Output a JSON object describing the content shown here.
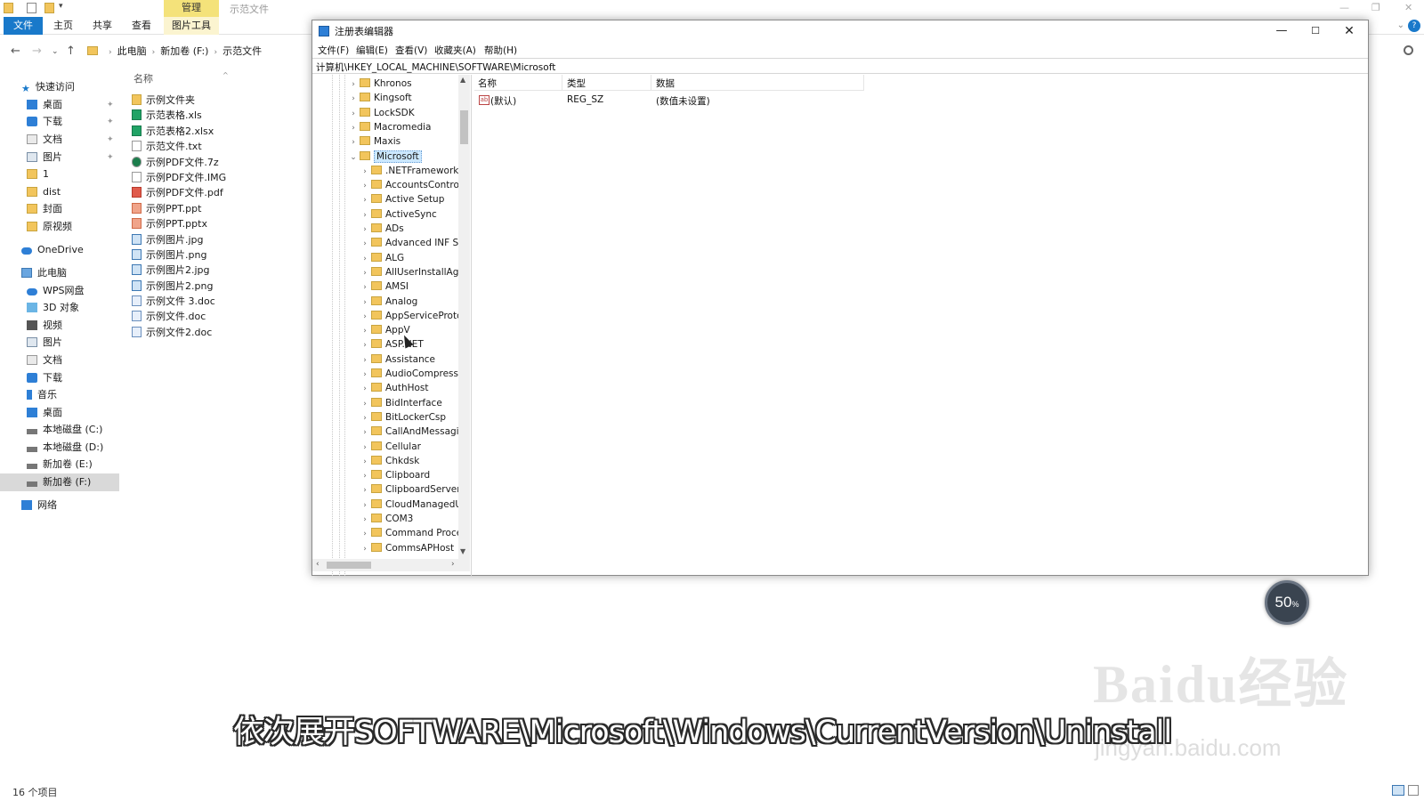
{
  "explorer": {
    "title": "示范文件",
    "manage_tab": "管理",
    "ribbon_tabs": [
      "文件",
      "主页",
      "共享",
      "查看",
      "图片工具"
    ],
    "breadcrumb": [
      "此电脑",
      "新加卷 (F:)",
      "示范文件"
    ],
    "nav_items": [
      {
        "label": "快速访问",
        "icon": "star-icon"
      },
      {
        "label": "桌面",
        "icon": "desktop-icon",
        "pinned": true
      },
      {
        "label": "下载",
        "icon": "download-icon",
        "pinned": true
      },
      {
        "label": "文档",
        "icon": "document-icon",
        "pinned": true
      },
      {
        "label": "图片",
        "icon": "picture-icon",
        "pinned": true
      },
      {
        "label": "1",
        "icon": "folder-icon"
      },
      {
        "label": "dist",
        "icon": "folder-icon"
      },
      {
        "label": "封面",
        "icon": "folder-icon"
      },
      {
        "label": "原视频",
        "icon": "folder-icon"
      },
      {
        "label": "OneDrive",
        "icon": "cloud-icon"
      },
      {
        "label": "此电脑",
        "icon": "computer-icon"
      },
      {
        "label": "WPS网盘",
        "icon": "cloud-icon"
      },
      {
        "label": "3D 对象",
        "icon": "cube-icon"
      },
      {
        "label": "视频",
        "icon": "video-icon"
      },
      {
        "label": "图片",
        "icon": "picture-icon"
      },
      {
        "label": "文档",
        "icon": "document-icon"
      },
      {
        "label": "下载",
        "icon": "download-icon"
      },
      {
        "label": "音乐",
        "icon": "music-icon"
      },
      {
        "label": "桌面",
        "icon": "desktop-icon"
      },
      {
        "label": "本地磁盘 (C:)",
        "icon": "drive-icon"
      },
      {
        "label": "本地磁盘 (D:)",
        "icon": "drive-icon"
      },
      {
        "label": "新加卷 (E:)",
        "icon": "drive-icon"
      },
      {
        "label": "新加卷 (F:)",
        "icon": "drive-icon",
        "selected": true
      },
      {
        "label": "网络",
        "icon": "network-icon"
      }
    ],
    "column_header": "名称",
    "files": [
      {
        "name": "示例文件夹",
        "kind": "folder"
      },
      {
        "name": "示范表格.xls",
        "kind": "xls"
      },
      {
        "name": "示范表格2.xlsx",
        "kind": "xls"
      },
      {
        "name": "示范文件.txt",
        "kind": "txt"
      },
      {
        "name": "示例PDF文件.7z",
        "kind": "7z"
      },
      {
        "name": "示例PDF文件.IMG",
        "kind": "img-file"
      },
      {
        "name": "示例PDF文件.pdf",
        "kind": "pdf"
      },
      {
        "name": "示例PPT.ppt",
        "kind": "ppt"
      },
      {
        "name": "示例PPT.pptx",
        "kind": "ppt"
      },
      {
        "name": "示例图片.jpg",
        "kind": "image"
      },
      {
        "name": "示例图片.png",
        "kind": "image"
      },
      {
        "name": "示例图片2.jpg",
        "kind": "image"
      },
      {
        "name": "示例图片2.png",
        "kind": "image"
      },
      {
        "name": "示例文件 3.doc",
        "kind": "doc"
      },
      {
        "name": "示例文件.doc",
        "kind": "doc"
      },
      {
        "name": "示例文件2.doc",
        "kind": "doc"
      }
    ],
    "status": "16 个项目"
  },
  "regedit": {
    "title": "注册表编辑器",
    "menu": [
      "文件(F)",
      "编辑(E)",
      "查看(V)",
      "收藏夹(A)",
      "帮助(H)"
    ],
    "address": "计算机\\HKEY_LOCAL_MACHINE\\SOFTWARE\\Microsoft",
    "tree_parent_keys": [
      "Khronos",
      "Kingsoft",
      "LockSDK",
      "Macromedia",
      "Maxis"
    ],
    "tree_selected_key": "Microsoft",
    "tree_child_keys": [
      ".NETFramework",
      "AccountsControl",
      "Active Setup",
      "ActiveSync",
      "ADs",
      "Advanced INF Se",
      "ALG",
      "AllUserInstallAge",
      "AMSI",
      "Analog",
      "AppServiceProto",
      "AppV",
      "ASP.NET",
      "Assistance",
      "AudioCompress",
      "AuthHost",
      "BidInterface",
      "BitLockerCsp",
      "CallAndMessagi",
      "Cellular",
      "Chkdsk",
      "Clipboard",
      "ClipboardServer",
      "CloudManagedU",
      "COM3",
      "Command Proce",
      "CommsAPHost"
    ],
    "columns": [
      "名称",
      "类型",
      "数据"
    ],
    "values": [
      {
        "name": "(默认)",
        "type": "REG_SZ",
        "data": "(数值未设置)"
      }
    ]
  },
  "progress": {
    "value": "50",
    "unit": "%"
  },
  "watermark": {
    "logo": "Baidu经验",
    "url": "jingyan.baidu.com"
  },
  "subtitle": "依次展开SOFTWARE\\Microsoft\\Windows\\CurrentVersion\\Uninstall"
}
